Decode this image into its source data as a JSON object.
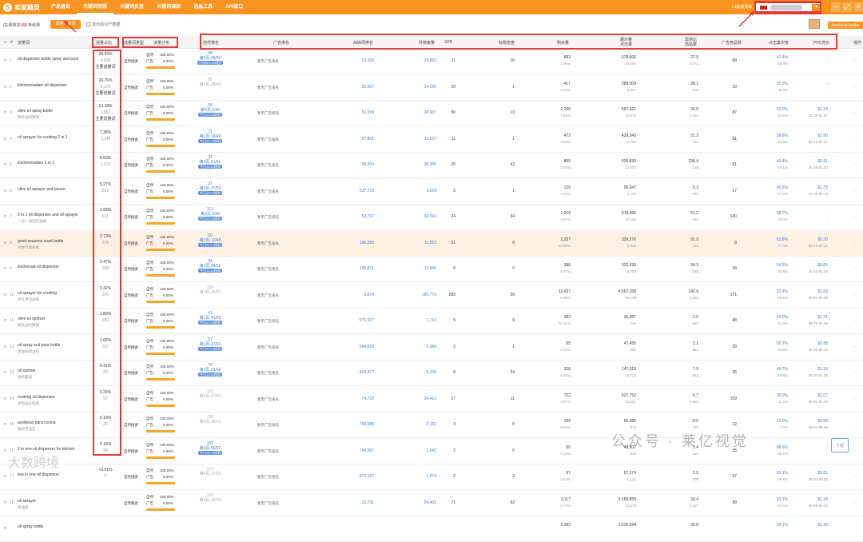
{
  "nav": {
    "logo": "卖家精灵",
    "items": [
      "产品查询",
      "关键词挖掘",
      "关键词反查",
      "关键词调研",
      "选品工具",
      "API接口"
    ],
    "credits": "21套餐剩余"
  },
  "toolbar": {
    "prefix": "[矢量地块]",
    "count": "68",
    "suffix": "条结果",
    "filter_btn": "调整关键词",
    "checkbox_label": "显示前10个数据",
    "right_btn": "添加到关键词收藏夹"
  },
  "headers": {
    "keyword": "流量词",
    "share": "流量占比",
    "traffic_type": "流量词类型",
    "dist": "流量分布",
    "nat_rank": "自然排名",
    "ad_rank": "广告排名",
    "aba": "ABA周排名",
    "monthly": "月搜索量",
    "spr": "SPR",
    "title_density": "标题密度",
    "purchase": "购买量",
    "impressions": "展示量\n点击量",
    "supply_demand": "需供比\n商品数",
    "ad_competitors": "广告竞品数",
    "click_share": "点击集中度",
    "ppc": "PPC竞价",
    "action": "操作"
  },
  "rows": [
    {
      "n": "1",
      "kw": "oil dispenser bottle spray and pour",
      "tr": "",
      "share": "28.92%",
      "share2": "4,695",
      "tag": "主要流量词",
      "nat": "自然搜索",
      "nr1": "48",
      "nr2": "第2页,48/50",
      "nr3": "7月前23:33搜到",
      "ad": "暂无广告排名",
      "aba": "63,326",
      "ms": "29,863",
      "spr": "21",
      "td": "16",
      "p1": "883",
      "p2": "2.96%",
      "i1": "678,606",
      "i2": "13,385",
      "s1": "27.9",
      "s2": "1,071",
      "ac": "84",
      "c1": "47.4%",
      "c2": "28.0%",
      "pp1": "-",
      "pp2": "-",
      "dim": false
    },
    {
      "n": "2",
      "kw": "kitchenmaiden oil dispenser",
      "tr": "",
      "share": "20.76%",
      "share2": "3,378",
      "tag": "主要流量词",
      "nat": "自然搜索",
      "nr1": "95",
      "nr2": "第2页,28/49",
      "nr3": "",
      "ad": "暂无广告排名",
      "aba": "25,957",
      "ms": "14,196",
      "spr": "10",
      "td": "1",
      "p1": "417",
      "p2": "2.94%",
      "i1": "389,009",
      "i2": "6,361",
      "s1": "28.1",
      "s2": "506",
      "ac": "19",
      "c1": "55.3%",
      "c2": "36.3%",
      "pp1": "-",
      "pp2": "-",
      "dim": true
    },
    {
      "n": "3",
      "kw": "olive oil spray bottle",
      "tr": "橄榄油喷雾瓶",
      "share": "13.18%",
      "share2": "2,057",
      "tag": "主要流量词",
      "nat": "自然搜索",
      "nr1": "58",
      "nr2": "第2页,5/49",
      "nr3": "今日20:15搜到",
      "ad": "暂无广告排名",
      "aba": "51,199",
      "ms": "28,607",
      "spr": "50",
      "td": "13",
      "p1": "2,156",
      "p2": "7.54%",
      "i1": "597,421",
      "i2": "13,979",
      "s1": "24.6",
      "s2": "1,164",
      "ac": "87",
      "c1": "53.0%",
      "c2": "36.6%",
      "pp1": "$1.34",
      "pp2": "$1.09-$1.67",
      "dim": false
    },
    {
      "n": "4",
      "kw": "oil sprayer for cooking 2 in 1",
      "tr": "",
      "share": "7.38%",
      "share2": "1,148",
      "tag": "",
      "nat": "自然搜索",
      "nr1": "71",
      "nr2": "第2页,18/49",
      "nr3": "今日20:16搜到",
      "ad": "暂无广告排名",
      "aba": "97,851",
      "ms": "15,537",
      "spr": "11",
      "td": "1",
      "p1": "472",
      "p2": "3.04%",
      "i1": "429,343",
      "i2": "6,755",
      "s1": "21.3",
      "s2": "731",
      "ac": "61",
      "c1": "58.8%",
      "c2": "23.9%",
      "pp1": "$1.50",
      "pp2": "$1.12-$1.87",
      "dim": false
    },
    {
      "n": "5",
      "kw": "kitchenmaiden 2 in 1",
      "tr": "",
      "share": "6.50%",
      "share2": "1,010",
      "tag": "",
      "nat": "自然搜索",
      "nr1": "91",
      "nr2": "第2页,41/49",
      "nr3": "今日20:14搜到",
      "ad": "暂无广告排名",
      "aba": "99,304",
      "ms": "30,365",
      "spr": "20",
      "td": "42",
      "p1": "865",
      "p2": "2.85%",
      "i1": "635,830",
      "i2": "12,497",
      "s1": "235.4",
      "s2": "129",
      "ac": "51",
      "c1": "49.4%",
      "c2": "24.1%",
      "pp1": "$0.91",
      "pp2": "$0.68-$1.00",
      "dim": false
    },
    {
      "n": "6",
      "kw": "olive oil sprayer and pourer",
      "tr": "",
      "share": "5.27%",
      "share2": "819",
      "tag": "",
      "nat": "自然搜索",
      "nr1": "37",
      "nr2": "第2页,37/53",
      "nr3": "今日20:17搜到",
      "ad": "暂无广告排名",
      "aba": "337,722",
      "ms": "3,629",
      "spr": "3",
      "td": "1",
      "p1": "125",
      "p2": "3.46%",
      "i1": "95,647",
      "i2": "1,729",
      "s1": "5.3",
      "s2": "679",
      "ac": "17",
      "c1": "60.5%",
      "c2": "47.2%",
      "pp1": "$1.75",
      "pp2": "$1.30-$2.19",
      "dim": false
    },
    {
      "n": "7",
      "kw": "2 in 1 oil dispenser and oil sprayer",
      "tr": "二合一油壶喷油器",
      "share": "3.93%",
      "share2": "611",
      "tag": "",
      "nat": "自然搜索",
      "nr1": "113",
      "nr2": "第3页,9/49",
      "nr3": "今日20:18搜到",
      "ad": "暂无广告排名",
      "aba": "52,767",
      "ms": "33,194",
      "spr": "24",
      "td": "34",
      "p1": "1,019",
      "p2": "3.07%",
      "i1": "919,495",
      "i2": "16,152",
      "s1": "51.2",
      "s2": "649",
      "ac": "140",
      "c1": "58.7%",
      "c2": "28.0%",
      "pp1": "-",
      "pp2": "-",
      "dim": false
    },
    {
      "n": "8",
      "kw": "good seasons cruet bottle",
      "tr": "好季节调味瓶",
      "share": "3.70%",
      "share2": "576",
      "tag": "",
      "nat": "自然搜索",
      "nr1": "60",
      "nr2": "第2页,12/48",
      "nr3": "今日20:17搜到",
      "ad": "暂无广告排名",
      "aba": "186,285",
      "ms": "11,853",
      "spr": "51",
      "td": "0",
      "p1": "2,237",
      "p2": "18.88%",
      "i1": "329,276",
      "i2": "5,549",
      "s1": "91.9",
      "s2": "129",
      "ac": "8",
      "c1": "83.8%",
      "c2": "77.4%",
      "pp1": "$0.20",
      "pp2": "$0.18-$0.21",
      "dim": false,
      "hl": true
    },
    {
      "n": "9",
      "kw": "kitchenaid oil dispenser",
      "tr": "",
      "share": "3.47%",
      "share2": "539",
      "tag": "",
      "nat": "自然搜索",
      "nr1": "84",
      "nr2": "第2页,34/52",
      "nr3": "今日12:40搜到",
      "ad": "暂无广告排名",
      "aba": "186,821",
      "ms": "12,655",
      "spr": "9",
      "td": "0",
      "p1": "388",
      "p2": "3.07%",
      "i1": "332,635",
      "i2": "5,753",
      "s1": "24.3",
      "s2": "520",
      "ac": "18",
      "c1": "54.5%",
      "c2": "32.5%",
      "pp1": "$0.85",
      "pp2": "$0.63-$1.06",
      "dim": false
    },
    {
      "n": "10",
      "kw": "oil sprayer for cooking",
      "tr": "烹饪用喷油器",
      "share": "2.42%",
      "share2": "376",
      "tag": "",
      "nat": "自然搜索",
      "nr1": "136",
      "nr2": "第3页,36/51",
      "nr3": "",
      "ad": "暂无广告排名",
      "aba": "3,874",
      "ms": "180,779",
      "spr": "283",
      "td": "39",
      "p1": "12,437",
      "p2": "6.88%",
      "i1": "4,567,168",
      "i2": "98,138",
      "s1": "142.9",
      "s2": "1,265",
      "ac": "171",
      "c1": "52.4%",
      "c2": "25.5%",
      "pp1": "$1.09",
      "pp2": "$0.81-$1.36",
      "dim": true
    },
    {
      "n": "11",
      "kw": "olive oil spritzer",
      "tr": "橄榄油喷雾器",
      "share": "1.80%",
      "share2": "280",
      "tag": "",
      "nat": "自然搜索",
      "nr1": "41",
      "nr2": "第1页,41/53",
      "nr3": "今日21:33搜到",
      "ad": "暂无广告排名",
      "aba": "971,927",
      "ms": "1,716",
      "spr": "9",
      "td": "9",
      "p1": "382",
      "p2": "22.31%",
      "i1": "36,987",
      "i2": "740",
      "s1": "2.6",
      "s2": "662",
      "ac": "48",
      "c1": "44.0%",
      "c2": "31.8%",
      "pp1": "$1.21",
      "pp2": "$0.75-$1.50",
      "dim": false
    },
    {
      "n": "12",
      "kw": "oil spray and pour bottle",
      "tr": "喷油和倒油瓶",
      "share": "1.65%",
      "share2": "257",
      "tag": "",
      "nat": "自然搜索",
      "nr1": "37",
      "nr2": "第1页,37/53",
      "nr3": "今日20:13搜到",
      "ad": "暂无广告排名",
      "aba": "984,829",
      "ms": "2,084",
      "spr": "2",
      "td": "1",
      "p1": "65",
      "p2": "3.13%",
      "i1": "47,455",
      "i2": "862",
      "s1": "2.1",
      "s2": "982",
      "ac": "29",
      "c1": "60.2%",
      "c2": "29.6%",
      "pp1": "$0.88",
      "pp2": "$0.52-$1.22",
      "dim": false
    },
    {
      "n": "13",
      "kw": "oil spritzer",
      "tr": "油喷雾器",
      "share": "0.41%",
      "share2": "63",
      "tag": "",
      "nat": "自然搜索",
      "nr1": "75",
      "nr2": "第2页,23/49",
      "nr3": "今日19:58搜到",
      "ad": "暂无广告排名",
      "aba": "402,477",
      "ms": "5,208",
      "spr": "8",
      "td": "24",
      "p1": "328",
      "p2": "6.31%",
      "i1": "147,518",
      "i2": "2,710",
      "s1": "7.9",
      "s2": "663",
      "ac": "26",
      "c1": "49.7%",
      "c2": "13.6%",
      "pp1": "$1.15",
      "pp2": "$0.87-$1.45",
      "dim": false
    },
    {
      "n": "14",
      "kw": "cooking oil dispenser",
      "tr": "食用油分配器",
      "share": "0.33%",
      "share2": "52",
      "tag": "",
      "nat": "自然搜索",
      "nr1": "121",
      "nr2": "第3页,17/49",
      "nr3": "",
      "ad": "暂无广告排名",
      "aba": "74,732",
      "ms": "24,412",
      "spr": "17",
      "td": "11",
      "p1": "722",
      "p2": "2.97%",
      "i1": "627,752",
      "i2": "11,661",
      "s1": "6.7",
      "s2": "3,660",
      "ac": "159",
      "c1": "25.0%",
      "c2": "11.2%",
      "pp1": "$1.07",
      "pp2": "$0.91-$1.45",
      "dim": true
    },
    {
      "n": "15",
      "kw": "aceiteras para cocina",
      "tr": "厨房用油壶",
      "share": "0.19%",
      "share2": "30",
      "tag": "",
      "nat": "自然搜索",
      "nr1": "135",
      "nr2": "第3页,36/51",
      "nr3": "",
      "ad": "暂无广告排名",
      "aba": "756,585",
      "ms": "2,182",
      "spr": "3",
      "td": "0",
      "p1": "109",
      "p2": "5.04%",
      "i1": "55,086",
      "i2": "974",
      "s1": "8.6",
      "s2": "255",
      "ac": "12",
      "c1": "25.0%",
      "c2": "7.7%",
      "pp1": "$0.68",
      "pp2": "$0.51-$0.86",
      "dim": true
    },
    {
      "n": "16",
      "kw": "2 in one oil dispenser for kitchen",
      "tr": "",
      "share": "0.16%",
      "share2": "24",
      "tag": "",
      "nat": "自然搜索",
      "nr1": "152",
      "nr2": "第3页,50/52",
      "nr3": "今日20:20搜到",
      "ad": "暂无广告排名",
      "aba": "756,387",
      "ms": "1,942",
      "spr": "2",
      "td": "0",
      "p1": "60",
      "p2": "3.13%",
      "i1": "48,307",
      "i2": "930",
      "s1": "2.4",
      "s2": "325",
      "ac": "25",
      "c1": "58.3%",
      "c2": "46.7%",
      "pp1": "-",
      "pp2": "-",
      "dim": false
    },
    {
      "n": "17",
      "kw": "two in one oil dispenser",
      "tr": "",
      "share": "<0.01%",
      "share2": "0",
      "tag": "",
      "nat": "自然搜索",
      "nr1": "172",
      "nr2": "第4页,17/52",
      "nr3": "",
      "ad": "暂无广告排名",
      "aba": "872,187",
      "ms": "1,974",
      "spr": "2",
      "td": "2",
      "p1": "67",
      "p2": "3.44%",
      "i1": "57,174",
      "i2": "1,141",
      "s1": "2.5",
      "s2": "795",
      "ac": "37",
      "c1": "69.1%",
      "c2": "38.5%",
      "pp1": "$0.81",
      "pp2": "$0.64-$0.99",
      "dim": true
    },
    {
      "n": "18",
      "kw": "oil sprayer",
      "tr": "喷油器",
      "share": "",
      "share2": "",
      "tag": "",
      "nat": "自然搜索",
      "nr1": "170",
      "nr2": "第4页,16/53",
      "nr3": "",
      "ad": "暂无广告排名",
      "aba": "22,791",
      "ms": "54,401",
      "spr": "71",
      "td": "62",
      "p1": "3,117",
      "p2": "5.73%",
      "i1": "1,169,859",
      "i2": "21,573",
      "s1": "33.4",
      "s2": "1,627",
      "ac": "89",
      "c1": "53.1%",
      "c2": "20.6%",
      "pp1": "$1.18",
      "pp2": "$0.95-$1.40",
      "dim": true
    },
    {
      "n": "",
      "kw": "oil spray bottle",
      "tr": "",
      "share": "",
      "share2": "",
      "tag": "",
      "nat": "",
      "nr1": "",
      "nr2": "",
      "nr3": "",
      "ad": "",
      "aba": "",
      "ms": "",
      "spr": "",
      "td": "",
      "p1": "2,283",
      "p2": "",
      "i1": "1,225,694",
      "i2": "",
      "s1": "30.8",
      "s2": "",
      "ac": "",
      "c1": "54.1%",
      "c2": "",
      "pp1": "$1.35",
      "pp2": "",
      "dim": true
    }
  ],
  "watermark": "公众号 · 莱亿视觉",
  "watermark2": "大数跨境",
  "download": "下载",
  "colors": {
    "brand": "#f7931e",
    "highlight": "#e53935",
    "link": "#3f7fd6"
  }
}
